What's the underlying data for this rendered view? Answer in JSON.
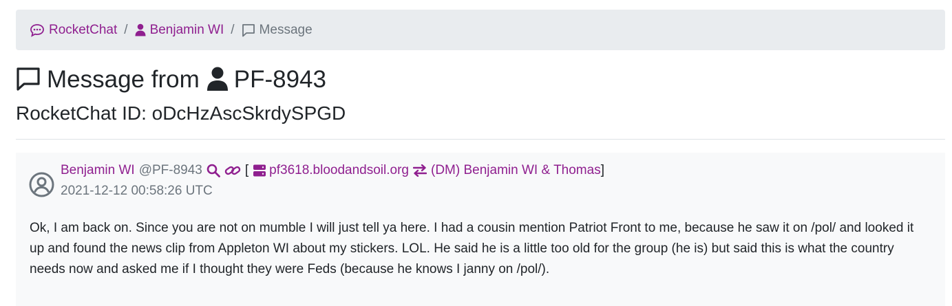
{
  "breadcrumb": {
    "items": [
      {
        "label": "RocketChat",
        "icon": "chat-dots-icon"
      },
      {
        "label": "Benjamin WI",
        "icon": "user-icon"
      },
      {
        "label": "Message",
        "icon": "message-square-icon"
      }
    ],
    "separator": "/"
  },
  "header": {
    "title_prefix": "Message from",
    "title_user": "PF-8943",
    "subtitle": "RocketChat ID: oDcHzAscSkrdySPGD"
  },
  "message": {
    "author_name": "Benjamin WI",
    "author_handle": "@PF-8943",
    "bracket_open": "[",
    "bracket_close": "]",
    "server": "pf3618.bloodandsoil.org",
    "channel": "(DM) Benjamin WI & Thomas",
    "timestamp": "2021-12-12 00:58:26 UTC",
    "body": "Ok, I am back on. Since you are not on mumble I will just tell ya here. I had a cousin mention Patriot Front to me, because he saw it on /pol/ and looked it up and found the news clip from Appleton WI about my stickers. LOL. He said he is a little too old for the group (he is) but said this is what the country needs now and asked me if I thought they were Feds (because he knows I janny on /pol/)."
  },
  "colors": {
    "accent": "#8f1f8f",
    "muted": "#6c757d",
    "breadcrumb_bg": "#e9ecef",
    "card_bg": "#f8f9fa"
  }
}
